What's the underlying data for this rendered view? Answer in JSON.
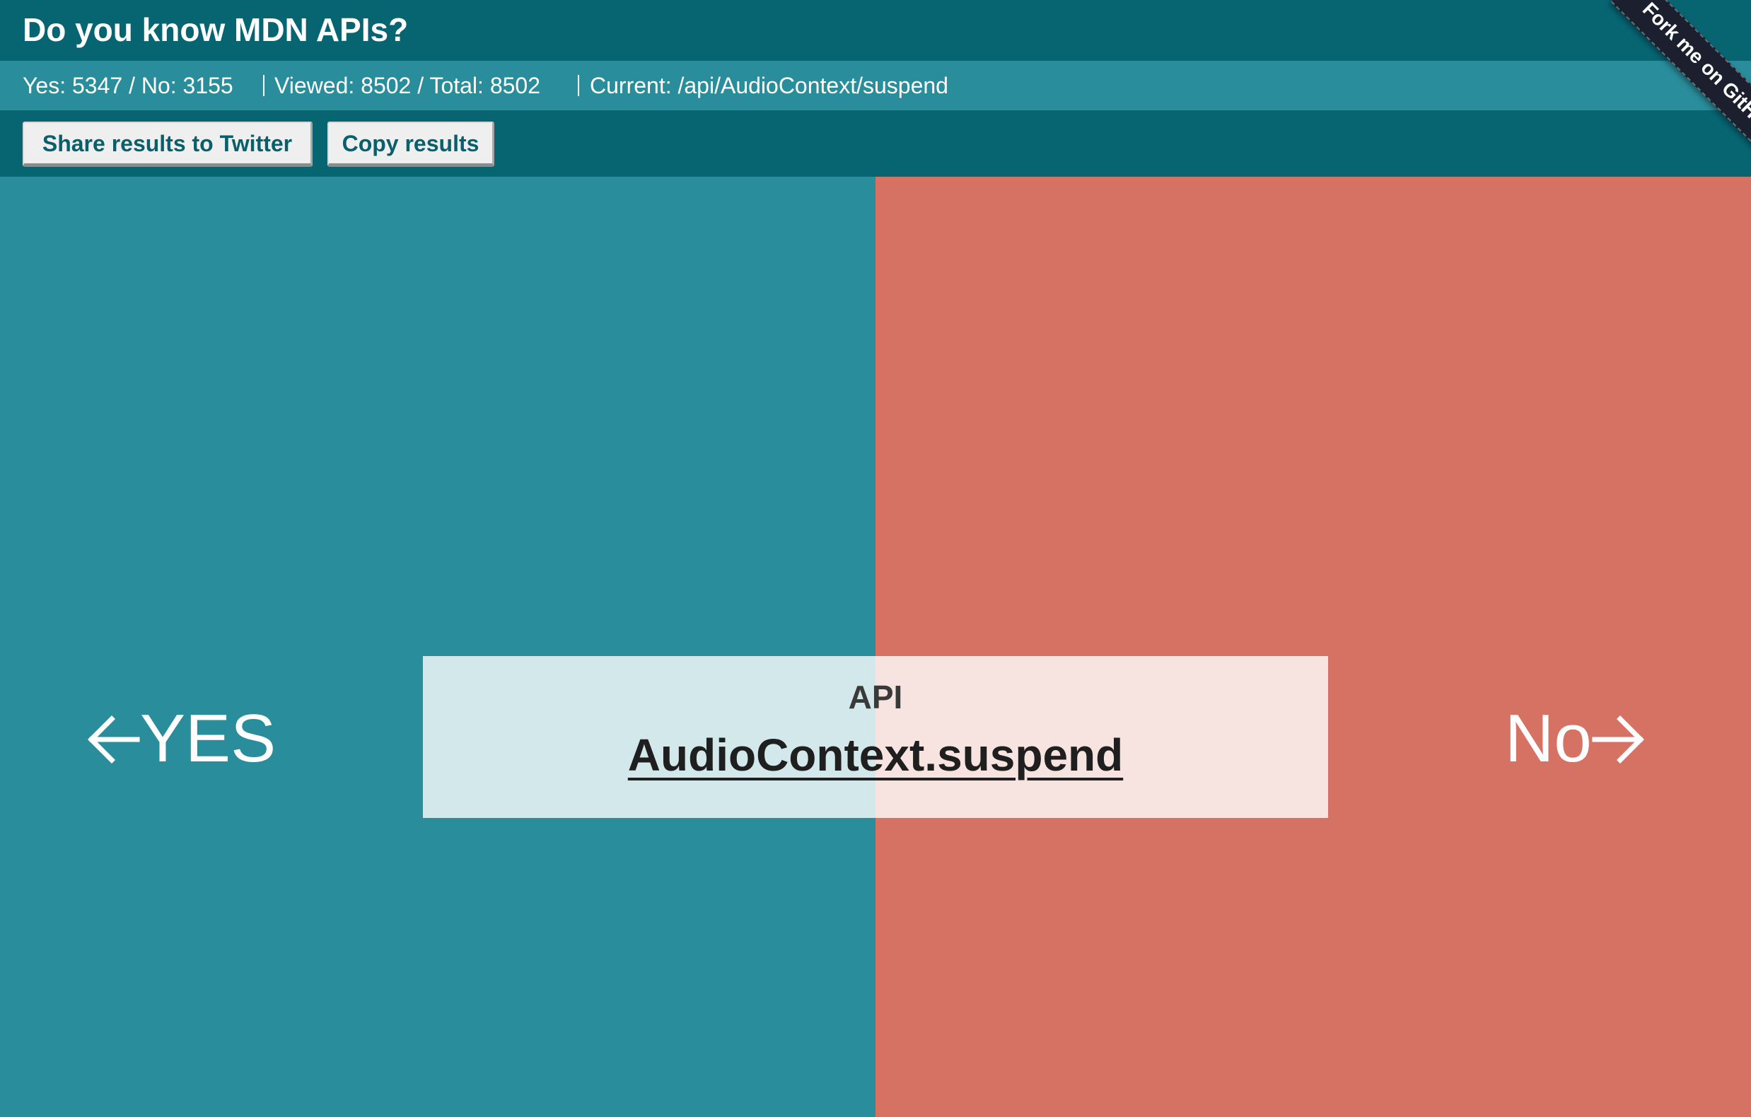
{
  "header": {
    "title": "Do you know MDN APIs?"
  },
  "stats": {
    "yes_no": "Yes: 5347 / No: 3155",
    "viewed_total": "Viewed: 8502 / Total: 8502",
    "current": "Current: /api/AudioContext/suspend"
  },
  "toolbar": {
    "share_label": "Share results to Twitter",
    "copy_label": "Copy results"
  },
  "choices": {
    "yes_label": "YES",
    "no_label": "No",
    "yes_icon": "arrow-left-icon",
    "no_icon": "arrow-right-icon"
  },
  "card": {
    "kind": "API",
    "name": "AudioContext.suspend"
  },
  "ribbon": {
    "label": "Fork me on GitHub"
  },
  "colors": {
    "header": "#076572",
    "yes_panel": "#2a8d9b",
    "no_panel": "#d67264"
  }
}
